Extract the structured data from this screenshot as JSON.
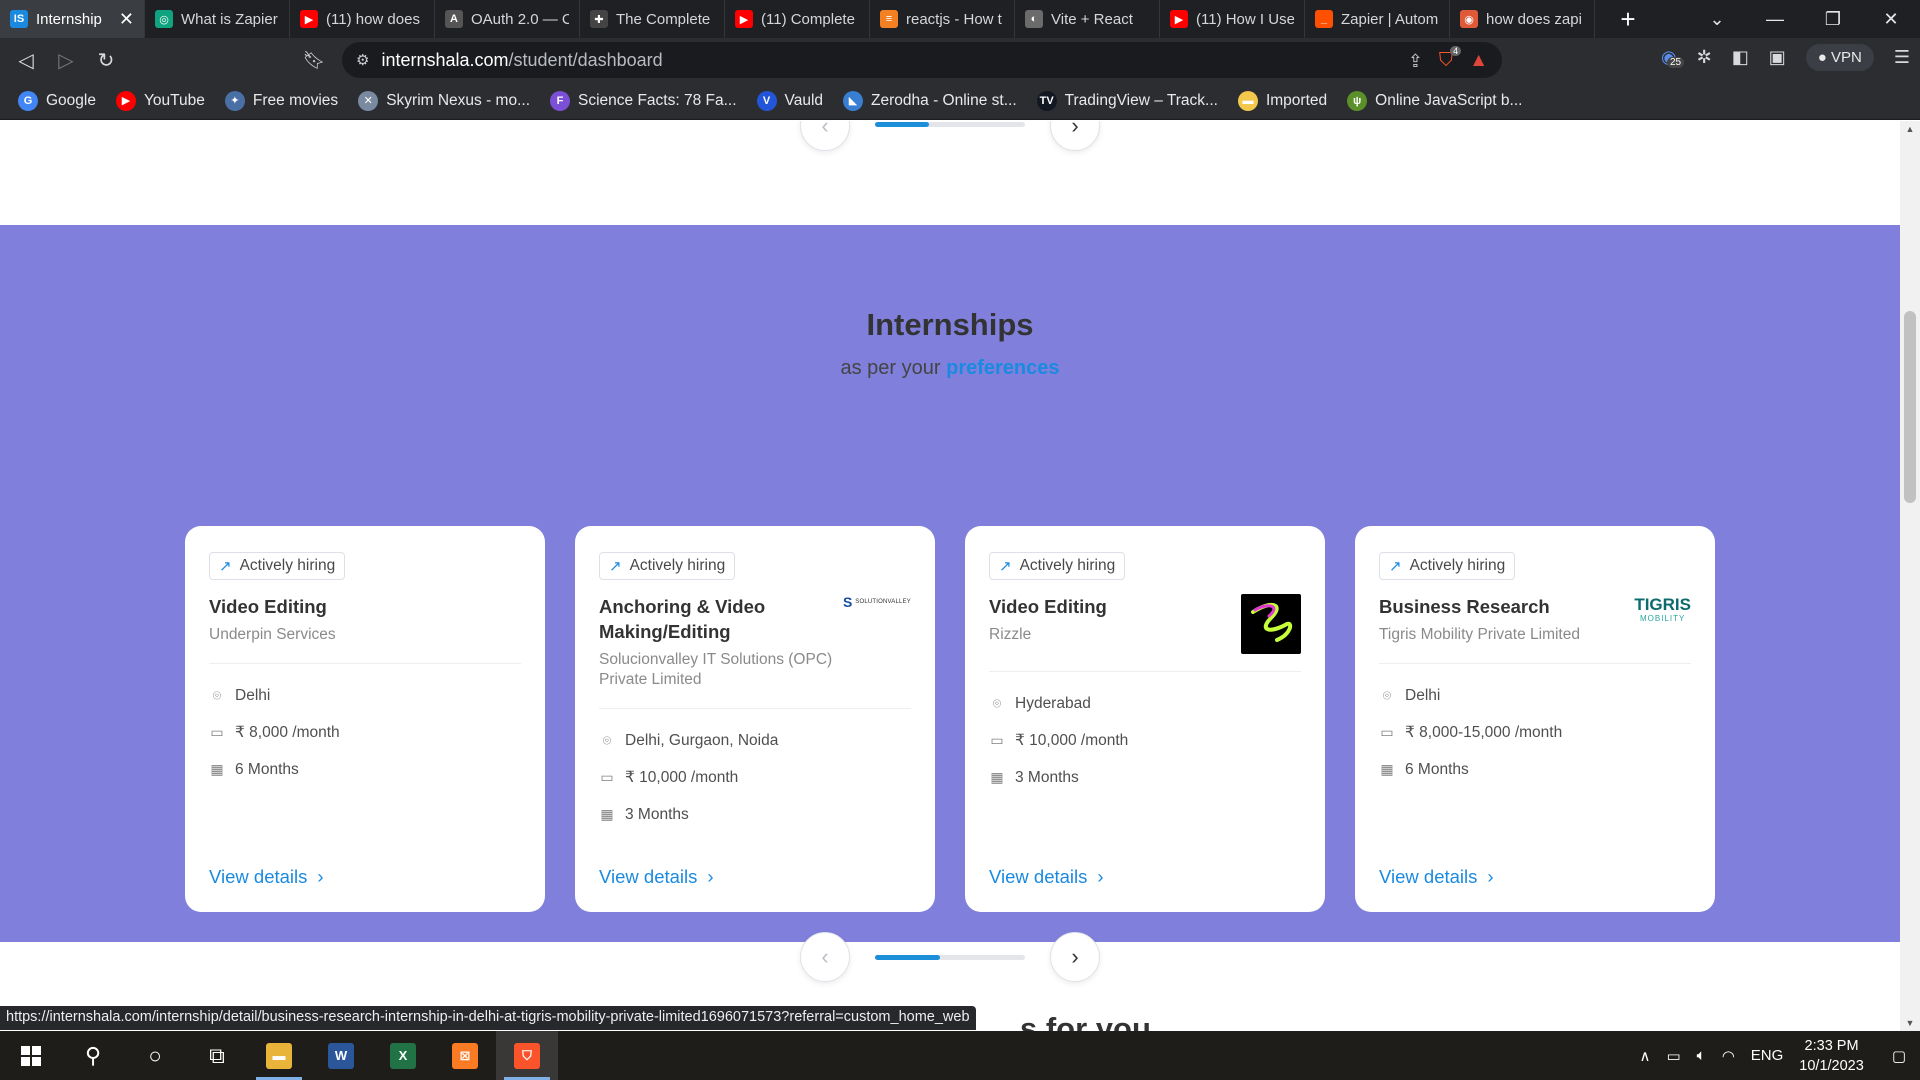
{
  "browser": {
    "tabs": [
      {
        "title": "Internship",
        "icon": "internshala-icon",
        "color": "#1a8ae0",
        "glyph": "IS",
        "active": true
      },
      {
        "title": "What is Zapier",
        "icon": "chatgpt-icon",
        "color": "#10a37f",
        "glyph": "◎"
      },
      {
        "title": "(11) how does",
        "icon": "youtube-icon",
        "color": "#ff0000",
        "glyph": "▶"
      },
      {
        "title": "OAuth 2.0 — C",
        "icon": "oauth-icon",
        "color": "#555555",
        "glyph": "A"
      },
      {
        "title": "The Complete",
        "icon": "shield-icon",
        "color": "#444444",
        "glyph": "✚"
      },
      {
        "title": "(11) Complete",
        "icon": "youtube-icon",
        "color": "#ff0000",
        "glyph": "▶"
      },
      {
        "title": "reactjs - How t",
        "icon": "stackoverflow-icon",
        "color": "#f48024",
        "glyph": "≡"
      },
      {
        "title": "Vite + React",
        "icon": "globe-icon",
        "color": "#6b6b6b",
        "glyph": "◐"
      },
      {
        "title": "(11) How I Use",
        "icon": "youtube-icon",
        "color": "#ff0000",
        "glyph": "▶"
      },
      {
        "title": "Zapier | Autom",
        "icon": "zapier-icon",
        "color": "#ff4f00",
        "glyph": "_"
      },
      {
        "title": "how does zapi",
        "icon": "brave-search-icon",
        "color": "#e05a3a",
        "glyph": "◉"
      }
    ],
    "url_host": "internshala.com",
    "url_path": "/student/dashboard",
    "brave_shield_count": "4",
    "extension_badge": "25",
    "vpn_label": "VPN",
    "bookmarks": [
      {
        "label": "Google",
        "icon": "google-icon",
        "color": "#4285f4",
        "glyph": "G"
      },
      {
        "label": "YouTube",
        "icon": "youtube-icon",
        "color": "#ff0000",
        "glyph": "▶"
      },
      {
        "label": "Free movies",
        "icon": "movies-icon",
        "color": "#4a6fa5",
        "glyph": "✦"
      },
      {
        "label": "Skyrim Nexus - mo...",
        "icon": "nexus-icon",
        "color": "#7a8aa0",
        "glyph": "✕"
      },
      {
        "label": "Science Facts: 78 Fa...",
        "icon": "science-facts-icon",
        "color": "#7b4fd6",
        "glyph": "F"
      },
      {
        "label": "Vauld",
        "icon": "vauld-icon",
        "color": "#2355d8",
        "glyph": "V"
      },
      {
        "label": "Zerodha - Online st...",
        "icon": "zerodha-icon",
        "color": "#387ed1",
        "glyph": "◣"
      },
      {
        "label": "TradingView – Track...",
        "icon": "tradingview-icon",
        "color": "#131722",
        "glyph": "TV"
      },
      {
        "label": "Imported",
        "icon": "folder-icon",
        "color": "#f2c94c",
        "glyph": "▬"
      },
      {
        "label": "Online JavaScript b...",
        "icon": "js-beautifier-icon",
        "color": "#5a8f29",
        "glyph": "ψ"
      }
    ]
  },
  "section": {
    "title": "Internships",
    "subtitle_prefix": "as per your",
    "subtitle_highlight": "preferences"
  },
  "cards": [
    {
      "badge": "Actively hiring",
      "role": "Video Editing",
      "company": "Underpin Services",
      "location": "Delhi",
      "stipend": "₹ 8,000 /month",
      "duration": "6 Months",
      "cta": "View details"
    },
    {
      "badge": "Actively hiring",
      "role": "Anchoring & Video Making/Editing",
      "company": "Solucionvalley IT Solutions (OPC) Private Limited",
      "location": "Delhi, Gurgaon, Noida",
      "stipend": "₹ 10,000 /month",
      "duration": "3 Months",
      "cta": "View details",
      "logo_text": "SOLUTIONVALLEY"
    },
    {
      "badge": "Actively hiring",
      "role": "Video Editing",
      "company": "Rizzle",
      "location": "Hyderabad",
      "stipend": "₹ 10,000 /month",
      "duration": "3 Months",
      "cta": "View details"
    },
    {
      "badge": "Actively hiring",
      "role": "Business Research",
      "company": "Tigris Mobility Private Limited",
      "location": "Delhi",
      "stipend": "₹ 8,000-15,000 /month",
      "duration": "6 Months",
      "cta": "View details",
      "logo_text": "TIGRIS",
      "logo_subtext": "MOBILITY"
    }
  ],
  "top_carousel_progress": 0.36,
  "bottom_carousel_progress": 0.43,
  "next_section_heading_partial": "s for you",
  "status_url": "https://internshala.com/internship/detail/business-research-internship-in-delhi-at-tigris-mobility-private-limited1696071573?referral=custom_home_web",
  "taskbar": {
    "language": "ENG",
    "time": "2:33 PM",
    "date": "10/1/2023"
  },
  "colors": {
    "band": "#8080dc",
    "accent": "#1a8ae0"
  }
}
